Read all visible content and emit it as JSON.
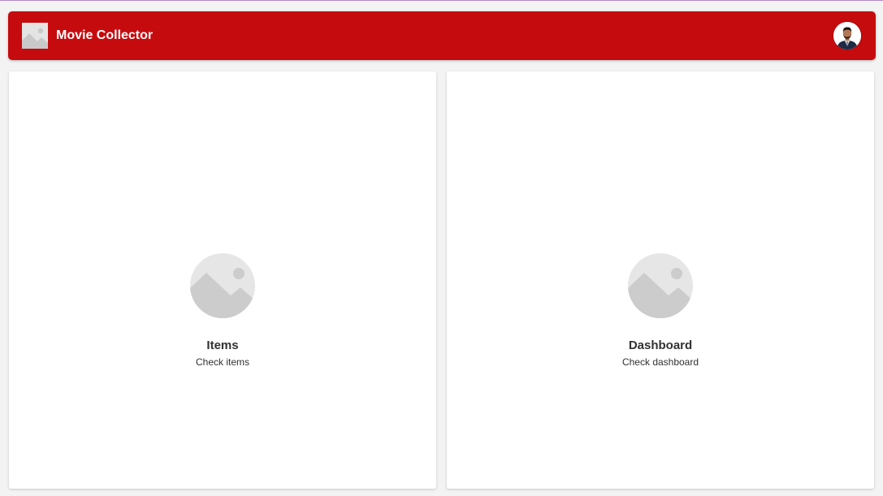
{
  "header": {
    "app_name": "Movie Collector",
    "logo_icon": "image-placeholder-icon",
    "avatar_icon": "user-avatar",
    "brand_color": "#c60b0e"
  },
  "cards": [
    {
      "title": "Items",
      "subtitle": "Check items",
      "icon": "image-placeholder-icon"
    },
    {
      "title": "Dashboard",
      "subtitle": "Check dashboard",
      "icon": "image-placeholder-icon"
    }
  ]
}
